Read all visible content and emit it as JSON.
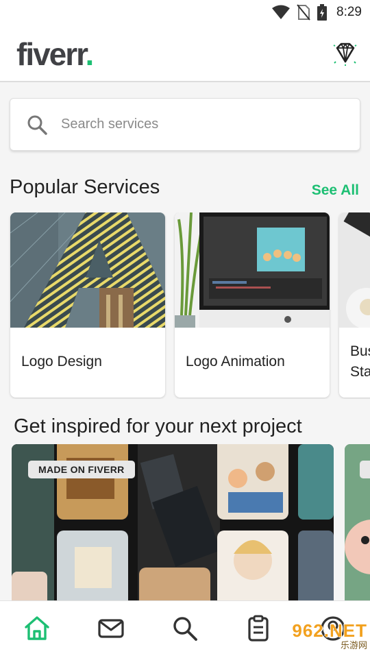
{
  "status_bar": {
    "time": "8:29",
    "icons": [
      "wifi-icon",
      "no-sim-icon",
      "battery-icon"
    ]
  },
  "header": {
    "logo_text": "fiverr",
    "logo_dot": ".",
    "brand_color": "#1dbf73",
    "action_icon": "diamond-icon"
  },
  "search": {
    "placeholder": "Search services",
    "value": ""
  },
  "popular": {
    "title": "Popular Services",
    "see_all": "See All",
    "cards": [
      {
        "label": "Logo Design"
      },
      {
        "label": "Logo Animation"
      },
      {
        "label": "Bus Sta"
      }
    ]
  },
  "inspire": {
    "title": "Get inspired for your next project",
    "badge": "MADE ON FIVERR"
  },
  "bottom_nav": {
    "items": [
      "home-icon",
      "inbox-icon",
      "search-icon",
      "orders-icon",
      "profile-icon"
    ],
    "active": "home-icon"
  },
  "watermark": {
    "main": "962.NET",
    "sub": "乐游网"
  }
}
